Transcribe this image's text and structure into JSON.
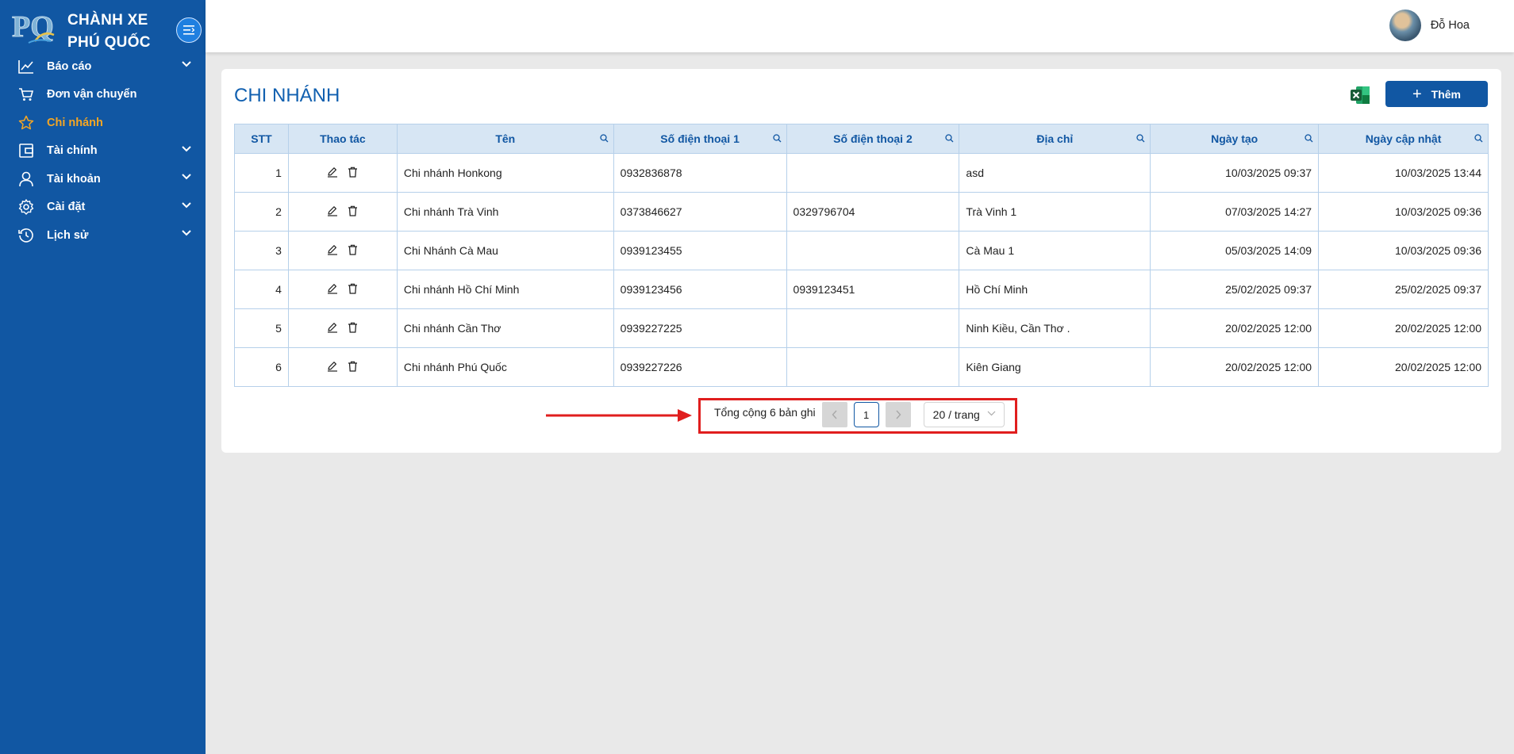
{
  "brand": {
    "logo_text": "PQ",
    "line1": "CHÀNH XE",
    "line2": "PHÚ QUỐC"
  },
  "sidebar": {
    "items": [
      {
        "label": "Báo cáo",
        "icon": "chart-line-icon",
        "expandable": true
      },
      {
        "label": "Đơn vận chuyển",
        "icon": "cart-icon",
        "expandable": false
      },
      {
        "label": "Chi nhánh",
        "icon": "star-icon",
        "expandable": false,
        "active": true
      },
      {
        "label": "Tài chính",
        "icon": "wallet-icon",
        "expandable": true
      },
      {
        "label": "Tài khoản",
        "icon": "user-icon",
        "expandable": true
      },
      {
        "label": "Cài đặt",
        "icon": "gear-icon",
        "expandable": true
      },
      {
        "label": "Lịch sử",
        "icon": "history-icon",
        "expandable": true
      }
    ]
  },
  "header": {
    "user_name": "Đỗ Hoa"
  },
  "page": {
    "title": "CHI NHÁNH",
    "add_label": "Thêm"
  },
  "table": {
    "columns": [
      "STT",
      "Thao tác",
      "Tên",
      "Số điện thoại 1",
      "Số điện thoại 2",
      "Địa chỉ",
      "Ngày tạo",
      "Ngày cập nhật"
    ],
    "rows": [
      {
        "stt": "1",
        "name": "Chi nhánh Honkong",
        "phone1": "0932836878",
        "phone2": "",
        "address": "asd",
        "created": "10/03/2025 09:37",
        "updated": "10/03/2025 13:44"
      },
      {
        "stt": "2",
        "name": "Chi nhánh Trà Vinh",
        "phone1": "0373846627",
        "phone2": "0329796704",
        "address": "Trà Vinh 1",
        "created": "07/03/2025 14:27",
        "updated": "10/03/2025 09:36"
      },
      {
        "stt": "3",
        "name": "Chi Nhánh Cà Mau",
        "phone1": "0939123455",
        "phone2": "",
        "address": "Cà Mau 1",
        "created": "05/03/2025 14:09",
        "updated": "10/03/2025 09:36"
      },
      {
        "stt": "4",
        "name": "Chi nhánh Hồ Chí Minh",
        "phone1": "0939123456",
        "phone2": "0939123451",
        "address": "Hồ Chí Minh",
        "created": "25/02/2025 09:37",
        "updated": "25/02/2025 09:37"
      },
      {
        "stt": "5",
        "name": "Chi nhánh Cần Thơ",
        "phone1": "0939227225",
        "phone2": "",
        "address": "Ninh Kiều, Cần Thơ .",
        "created": "20/02/2025 12:00",
        "updated": "20/02/2025 12:00"
      },
      {
        "stt": "6",
        "name": "Chi nhánh Phú Quốc",
        "phone1": "0939227226",
        "phone2": "",
        "address": "Kiên Giang",
        "created": "20/02/2025 12:00",
        "updated": "20/02/2025 12:00"
      }
    ]
  },
  "pagination": {
    "total_text": "Tổng cộng 6 bản ghi",
    "current_page": "1",
    "page_size": "20 / trang"
  },
  "colors": {
    "sidebar": "#1157a3",
    "active": "#f5a623",
    "header_bg": "#d7e6f4",
    "highlight": "#e01e1e"
  }
}
